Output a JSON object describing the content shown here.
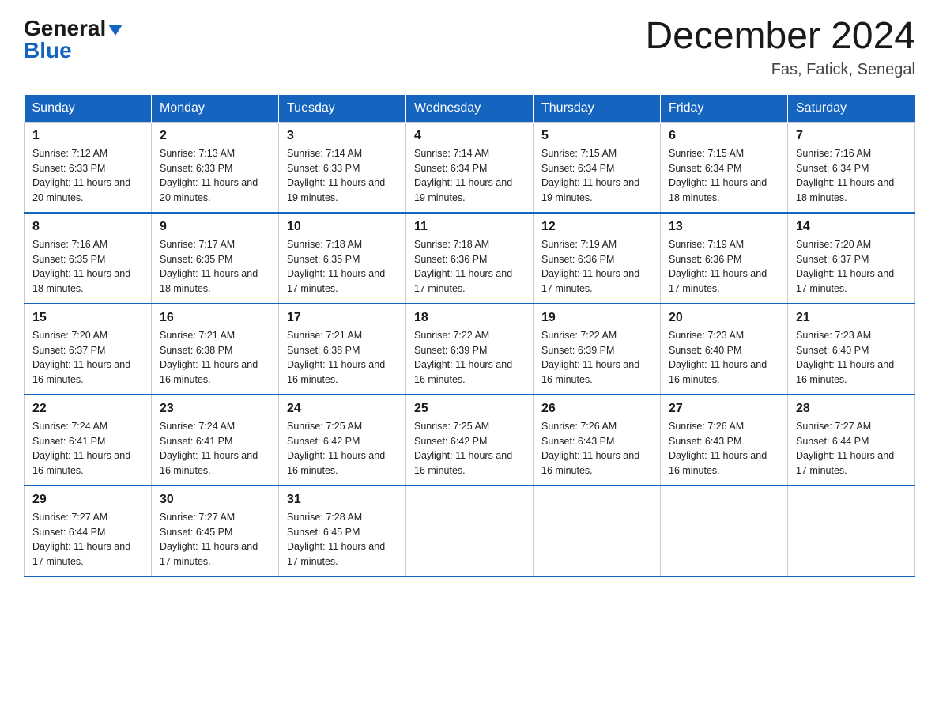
{
  "header": {
    "logo_general": "General",
    "logo_blue": "Blue",
    "month_title": "December 2024",
    "location": "Fas, Fatick, Senegal"
  },
  "weekdays": [
    "Sunday",
    "Monday",
    "Tuesday",
    "Wednesday",
    "Thursday",
    "Friday",
    "Saturday"
  ],
  "weeks": [
    [
      {
        "day": "1",
        "sunrise": "7:12 AM",
        "sunset": "6:33 PM",
        "daylight": "11 hours and 20 minutes."
      },
      {
        "day": "2",
        "sunrise": "7:13 AM",
        "sunset": "6:33 PM",
        "daylight": "11 hours and 20 minutes."
      },
      {
        "day": "3",
        "sunrise": "7:14 AM",
        "sunset": "6:33 PM",
        "daylight": "11 hours and 19 minutes."
      },
      {
        "day": "4",
        "sunrise": "7:14 AM",
        "sunset": "6:34 PM",
        "daylight": "11 hours and 19 minutes."
      },
      {
        "day": "5",
        "sunrise": "7:15 AM",
        "sunset": "6:34 PM",
        "daylight": "11 hours and 19 minutes."
      },
      {
        "day": "6",
        "sunrise": "7:15 AM",
        "sunset": "6:34 PM",
        "daylight": "11 hours and 18 minutes."
      },
      {
        "day": "7",
        "sunrise": "7:16 AM",
        "sunset": "6:34 PM",
        "daylight": "11 hours and 18 minutes."
      }
    ],
    [
      {
        "day": "8",
        "sunrise": "7:16 AM",
        "sunset": "6:35 PM",
        "daylight": "11 hours and 18 minutes."
      },
      {
        "day": "9",
        "sunrise": "7:17 AM",
        "sunset": "6:35 PM",
        "daylight": "11 hours and 18 minutes."
      },
      {
        "day": "10",
        "sunrise": "7:18 AM",
        "sunset": "6:35 PM",
        "daylight": "11 hours and 17 minutes."
      },
      {
        "day": "11",
        "sunrise": "7:18 AM",
        "sunset": "6:36 PM",
        "daylight": "11 hours and 17 minutes."
      },
      {
        "day": "12",
        "sunrise": "7:19 AM",
        "sunset": "6:36 PM",
        "daylight": "11 hours and 17 minutes."
      },
      {
        "day": "13",
        "sunrise": "7:19 AM",
        "sunset": "6:36 PM",
        "daylight": "11 hours and 17 minutes."
      },
      {
        "day": "14",
        "sunrise": "7:20 AM",
        "sunset": "6:37 PM",
        "daylight": "11 hours and 17 minutes."
      }
    ],
    [
      {
        "day": "15",
        "sunrise": "7:20 AM",
        "sunset": "6:37 PM",
        "daylight": "11 hours and 16 minutes."
      },
      {
        "day": "16",
        "sunrise": "7:21 AM",
        "sunset": "6:38 PM",
        "daylight": "11 hours and 16 minutes."
      },
      {
        "day": "17",
        "sunrise": "7:21 AM",
        "sunset": "6:38 PM",
        "daylight": "11 hours and 16 minutes."
      },
      {
        "day": "18",
        "sunrise": "7:22 AM",
        "sunset": "6:39 PM",
        "daylight": "11 hours and 16 minutes."
      },
      {
        "day": "19",
        "sunrise": "7:22 AM",
        "sunset": "6:39 PM",
        "daylight": "11 hours and 16 minutes."
      },
      {
        "day": "20",
        "sunrise": "7:23 AM",
        "sunset": "6:40 PM",
        "daylight": "11 hours and 16 minutes."
      },
      {
        "day": "21",
        "sunrise": "7:23 AM",
        "sunset": "6:40 PM",
        "daylight": "11 hours and 16 minutes."
      }
    ],
    [
      {
        "day": "22",
        "sunrise": "7:24 AM",
        "sunset": "6:41 PM",
        "daylight": "11 hours and 16 minutes."
      },
      {
        "day": "23",
        "sunrise": "7:24 AM",
        "sunset": "6:41 PM",
        "daylight": "11 hours and 16 minutes."
      },
      {
        "day": "24",
        "sunrise": "7:25 AM",
        "sunset": "6:42 PM",
        "daylight": "11 hours and 16 minutes."
      },
      {
        "day": "25",
        "sunrise": "7:25 AM",
        "sunset": "6:42 PM",
        "daylight": "11 hours and 16 minutes."
      },
      {
        "day": "26",
        "sunrise": "7:26 AM",
        "sunset": "6:43 PM",
        "daylight": "11 hours and 16 minutes."
      },
      {
        "day": "27",
        "sunrise": "7:26 AM",
        "sunset": "6:43 PM",
        "daylight": "11 hours and 16 minutes."
      },
      {
        "day": "28",
        "sunrise": "7:27 AM",
        "sunset": "6:44 PM",
        "daylight": "11 hours and 17 minutes."
      }
    ],
    [
      {
        "day": "29",
        "sunrise": "7:27 AM",
        "sunset": "6:44 PM",
        "daylight": "11 hours and 17 minutes."
      },
      {
        "day": "30",
        "sunrise": "7:27 AM",
        "sunset": "6:45 PM",
        "daylight": "11 hours and 17 minutes."
      },
      {
        "day": "31",
        "sunrise": "7:28 AM",
        "sunset": "6:45 PM",
        "daylight": "11 hours and 17 minutes."
      },
      null,
      null,
      null,
      null
    ]
  ]
}
